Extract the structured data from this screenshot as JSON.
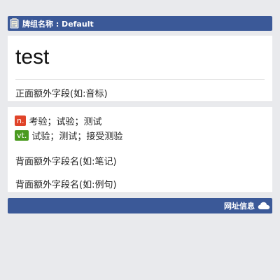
{
  "header": {
    "deck_label": "牌组名称 : Default",
    "icon": "notebook-icon"
  },
  "front": {
    "word": "test",
    "extra_field": "正面额外字段(如:音标)"
  },
  "back": {
    "definitions": [
      {
        "pos": "n.",
        "pos_color": "#e0442a",
        "meaning": "考验；试验；测试"
      },
      {
        "pos": "vt.",
        "pos_color": "#4a9a1f",
        "meaning": "试验；测试；接受测验"
      }
    ],
    "extra_fields": [
      "背面额外字段名(如:笔记)",
      "背面额外字段名(如:例句)"
    ]
  },
  "footer": {
    "link_label": "网址信息",
    "icon": "cloud-icon"
  },
  "colors": {
    "bar": "#3b5998",
    "background": "#e9eaed"
  }
}
